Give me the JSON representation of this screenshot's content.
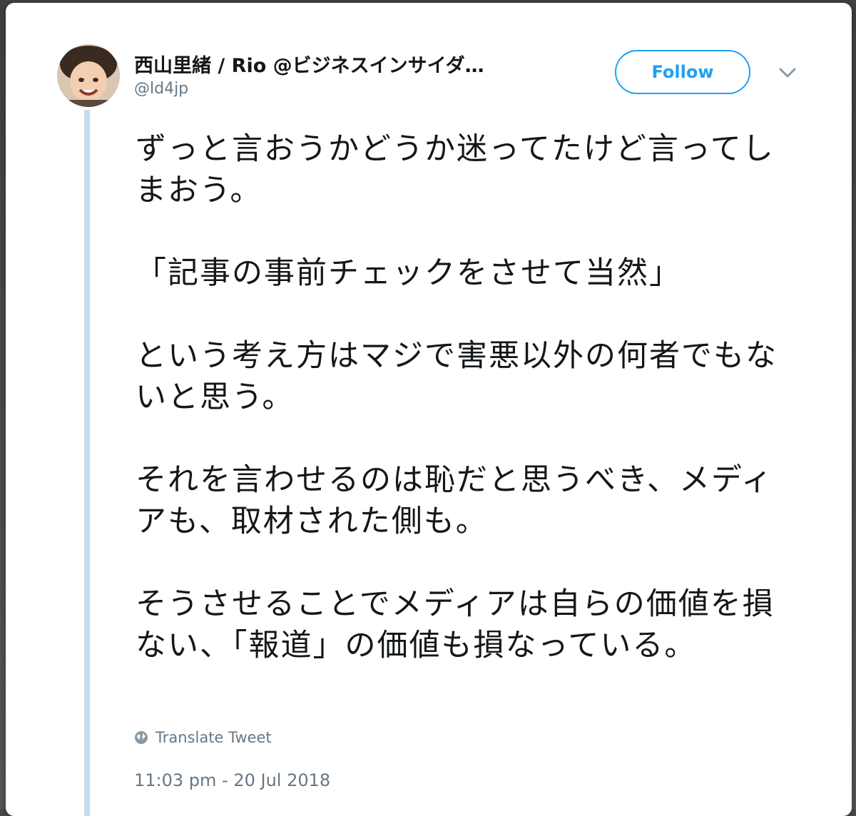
{
  "tweet": {
    "author_name": "西山里緒 / Rio @ビジネスインサイダ…",
    "author_handle": "@ld4jp",
    "follow_label": "Follow",
    "paragraphs": [
      "ずっと言おうかどうか迷ってたけど言ってしまおう。",
      "「記事の事前チェックをさせて当然」",
      "という考え方はマジで害悪以外の何者でもないと思う。",
      "それを言わせるのは恥だと思うべき、メディアも、取材された側も。",
      "そうさせることでメディアは自らの価値を損ない、「報道」の価値も損なっている。"
    ],
    "translate_label": "Translate Tweet",
    "timestamp": "11:03 pm - 20 Jul 2018"
  },
  "icons": {
    "avatar": "avatar",
    "menu": "chevron-down-icon",
    "translate": "globe-icon"
  },
  "colors": {
    "accent": "#1da1f2",
    "thread_line": "#c4dcf2",
    "text": "#14171a",
    "secondary": "#657786"
  }
}
